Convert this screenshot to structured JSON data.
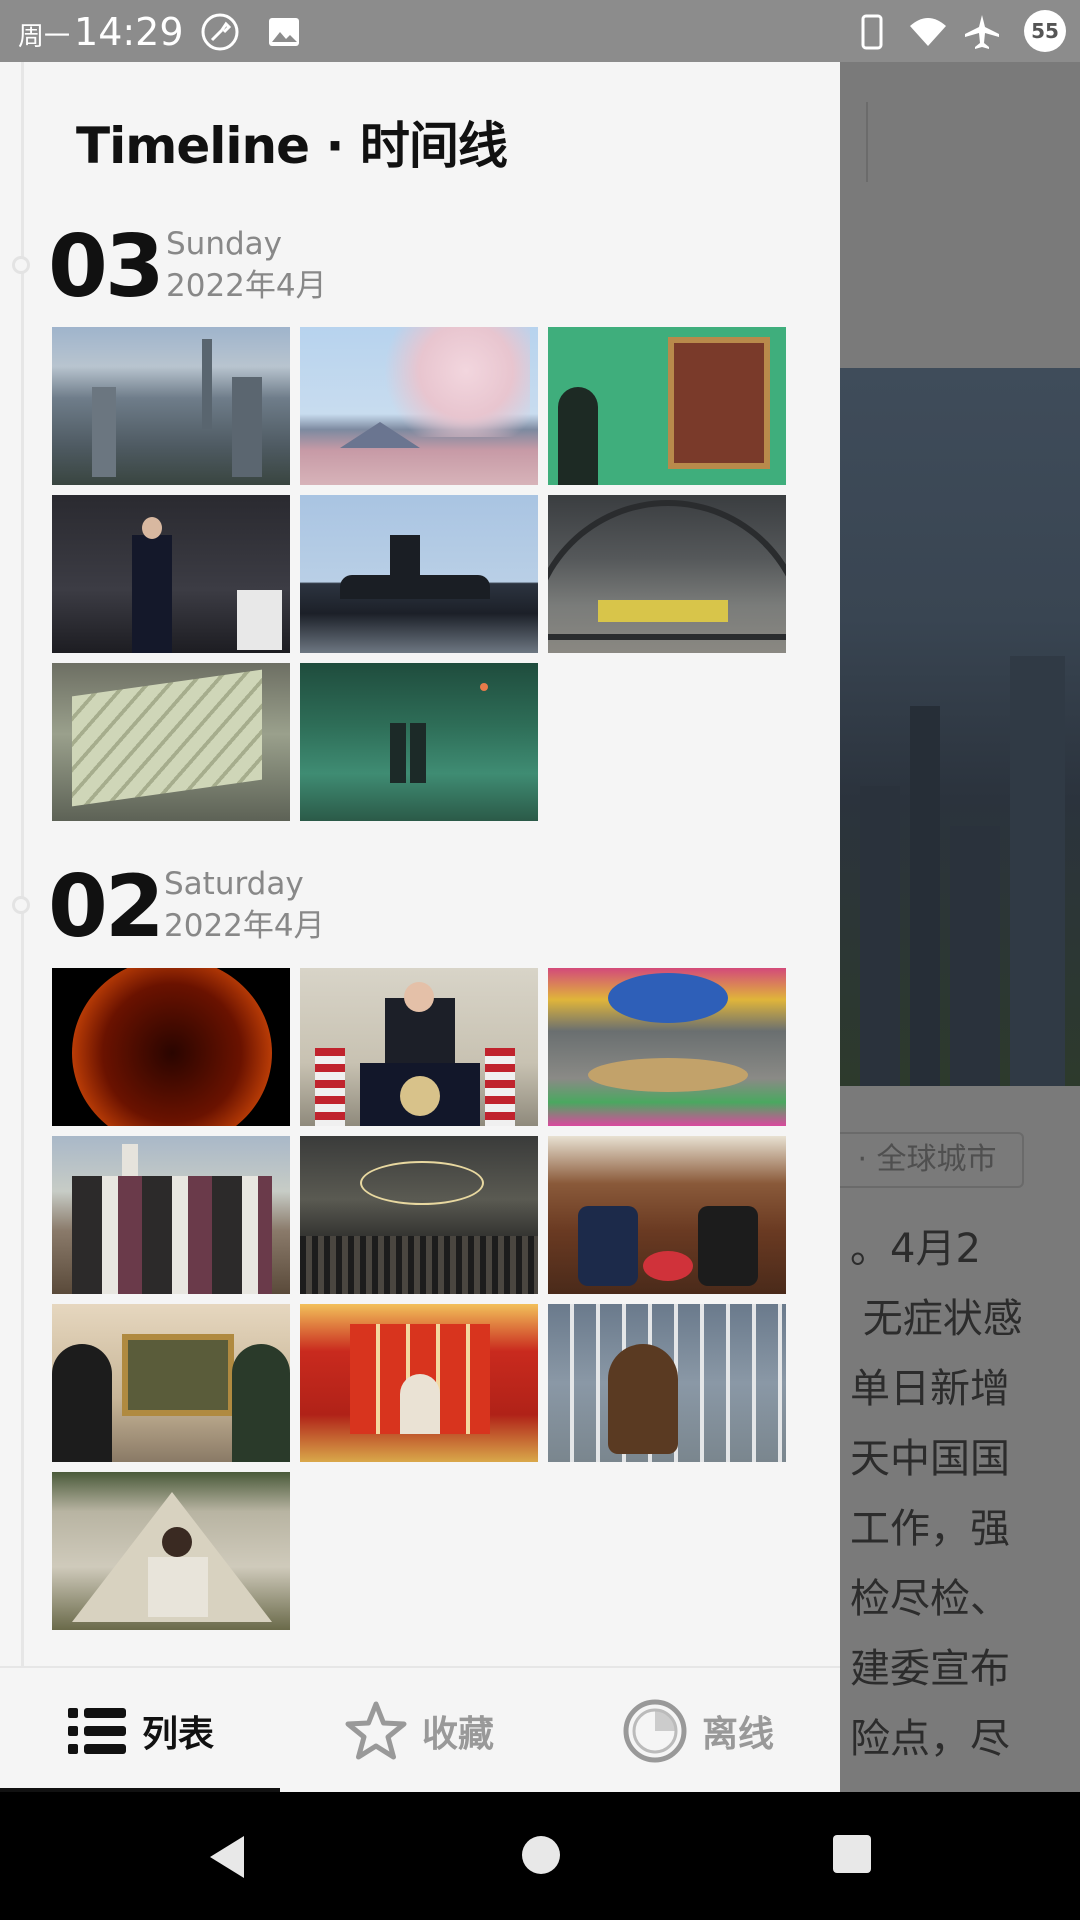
{
  "status_bar": {
    "day": "周一",
    "time": "14:29",
    "battery": "55",
    "colors": {
      "bar": "#8c8c8c"
    }
  },
  "drawer": {
    "title": "Timeline · 时间线",
    "days": [
      {
        "day_number": "03",
        "weekday": "Sunday",
        "month": "2022年4月",
        "photos": [
          "city-skyline",
          "cherry-blossom-mount-fuji",
          "woman-walking-past-painting",
          "politician-waving-crowd",
          "submarine-crew",
          "destroyed-aircraft-hangar",
          "stacks-of-banknotes",
          "underwater-feet"
        ]
      },
      {
        "day_number": "02",
        "weekday": "Saturday",
        "month": "2022年4月",
        "photos": [
          "sun-solar-flare",
          "president-at-podium",
          "round-table-conference-room",
          "group-of-men-outdoors",
          "mosque-chandeliers-crowd",
          "diplomats-meeting",
          "women-with-painting",
          "red-gold-room",
          "monkey-in-cage",
          "canada-goose-tent"
        ]
      }
    ]
  },
  "bottom_nav": [
    {
      "label": "列表",
      "icon": "list-icon",
      "active": true
    },
    {
      "label": "收藏",
      "icon": "star-icon",
      "active": false
    },
    {
      "label": "离线",
      "icon": "offline-icon",
      "active": false
    }
  ],
  "background_article": {
    "tag": "· 全球城市",
    "paragraph": "。4月2\n 无症状感\n单日新增\n天中国国\n工作，强\n检尽检、\n建委宣布\n险点，尽"
  }
}
